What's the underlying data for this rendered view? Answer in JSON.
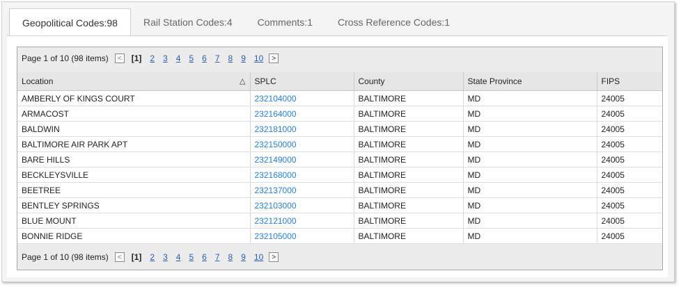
{
  "tabs": [
    {
      "label": "Geopolitical Codes:98",
      "active": true
    },
    {
      "label": "Rail Station Codes:4",
      "active": false
    },
    {
      "label": "Comments:1",
      "active": false
    },
    {
      "label": "Cross Reference Codes:1",
      "active": false
    }
  ],
  "pager": {
    "info": "Page 1 of 10 (98 items)",
    "prev_glyph": "<",
    "next_glyph": ">",
    "current": "[1]",
    "pages": [
      "2",
      "3",
      "4",
      "5",
      "6",
      "7",
      "8",
      "9",
      "10"
    ]
  },
  "columns": [
    "Location",
    "SPLC",
    "County",
    "State Province",
    "FIPS"
  ],
  "sort_glyph": "△",
  "rows": [
    [
      "AMBERLY OF KINGS COURT",
      "232104000",
      "BALTIMORE",
      "MD",
      "24005"
    ],
    [
      "ARMACOST",
      "232164000",
      "BALTIMORE",
      "MD",
      "24005"
    ],
    [
      "BALDWIN",
      "232181000",
      "BALTIMORE",
      "MD",
      "24005"
    ],
    [
      "BALTIMORE AIR PARK APT",
      "232150000",
      "BALTIMORE",
      "MD",
      "24005"
    ],
    [
      "BARE HILLS",
      "232149000",
      "BALTIMORE",
      "MD",
      "24005"
    ],
    [
      "BECKLEYSVILLE",
      "232168000",
      "BALTIMORE",
      "MD",
      "24005"
    ],
    [
      "BEETREE",
      "232137000",
      "BALTIMORE",
      "MD",
      "24005"
    ],
    [
      "BENTLEY SPRINGS",
      "232103000",
      "BALTIMORE",
      "MD",
      "24005"
    ],
    [
      "BLUE MOUNT",
      "232121000",
      "BALTIMORE",
      "MD",
      "24005"
    ],
    [
      "BONNIE RIDGE",
      "232105000",
      "BALTIMORE",
      "MD",
      "24005"
    ]
  ],
  "colors": {
    "link": "#2a7fd6",
    "pager_link": "#2a5db0"
  }
}
